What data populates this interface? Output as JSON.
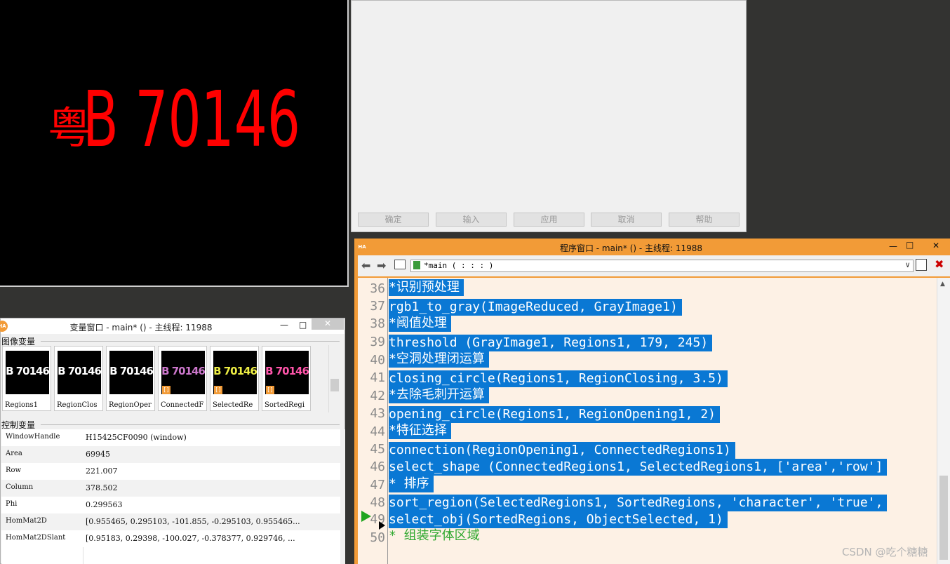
{
  "graphics": {
    "plate_text": "B 70146",
    "plate_prefix": "粤"
  },
  "dialog": {
    "buttons": [
      "确定",
      "输入",
      "应用",
      "取消",
      "帮助"
    ]
  },
  "variable_window": {
    "title": "变量窗口 - main* () - 主线程: 11988",
    "icon_vars_label": "图像变量",
    "control_vars_label": "控制变量",
    "thumbs": [
      {
        "caption": "Regions1",
        "badge": "",
        "tint": "#ffffff"
      },
      {
        "caption": "RegionClos",
        "badge": "",
        "tint": "#ffffff"
      },
      {
        "caption": "RegionOper",
        "badge": "",
        "tint": "#ffffff"
      },
      {
        "caption": "ConnectedF",
        "badge": "[]",
        "tint": "#c7c"
      },
      {
        "caption": "SelectedRe",
        "badge": "[]",
        "tint": "#ee4"
      },
      {
        "caption": "SortedRegi",
        "badge": "[]",
        "tint": "#f5a"
      }
    ],
    "control_vars": [
      {
        "name": "WindowHandle",
        "value": "H15425CF0090 (window)"
      },
      {
        "name": "Area",
        "value": "69945"
      },
      {
        "name": "Row",
        "value": "221.007"
      },
      {
        "name": "Column",
        "value": "378.502"
      },
      {
        "name": "Phi",
        "value": "0.299563"
      },
      {
        "name": "HomMat2D",
        "value": "[0.955465, 0.295103, -101.855, -0.295103, 0.955465..."
      },
      {
        "name": "HomMat2DSlant",
        "value": "[0.95183, 0.29398, -100.027, -0.378377, 0.929746, ..."
      }
    ]
  },
  "program_window": {
    "title": "程序窗口 - main* () - 主线程: 11988",
    "procedure": "*main ( : : : )",
    "lines": [
      {
        "n": "36",
        "text": "*识别预处理",
        "sel": true,
        "comment": false
      },
      {
        "n": "37",
        "text": "rgb1_to_gray(ImageReduced, GrayImage1)",
        "sel": true,
        "comment": false
      },
      {
        "n": "38",
        "text": "*阈值处理",
        "sel": true,
        "comment": false
      },
      {
        "n": "39",
        "text": "threshold (GrayImage1, Regions1, 179, 245)",
        "sel": true,
        "comment": false
      },
      {
        "n": "40",
        "text": "*空洞处理闭运算",
        "sel": true,
        "comment": false
      },
      {
        "n": "41",
        "text": "closing_circle(Regions1, RegionClosing, 3.5)",
        "sel": true,
        "comment": false
      },
      {
        "n": "42",
        "text": "*去除毛刺开运算",
        "sel": true,
        "comment": false
      },
      {
        "n": "43",
        "text": "opening_circle(Regions1, RegionOpening1, 2)",
        "sel": true,
        "comment": false
      },
      {
        "n": "44",
        "text": "*特征选择",
        "sel": true,
        "comment": false
      },
      {
        "n": "45",
        "text": "connection(RegionOpening1, ConnectedRegions1)",
        "sel": true,
        "comment": false
      },
      {
        "n": "46",
        "text": "select_shape (ConnectedRegions1, SelectedRegions1, ['area','row']",
        "sel": true,
        "comment": false
      },
      {
        "n": "47",
        "text": "* 排序",
        "sel": true,
        "comment": false
      },
      {
        "n": "48",
        "text": "sort_region(SelectedRegions1, SortedRegions, 'character', 'true',",
        "sel": true,
        "comment": false
      },
      {
        "n": "49",
        "text": "select_obj(SortedRegions, ObjectSelected, 1)",
        "sel": true,
        "comment": false
      },
      {
        "n": "50",
        "text": "* 组装字体区域",
        "sel": false,
        "comment": true
      }
    ]
  },
  "watermark": "CSDN @吃个糖糖"
}
